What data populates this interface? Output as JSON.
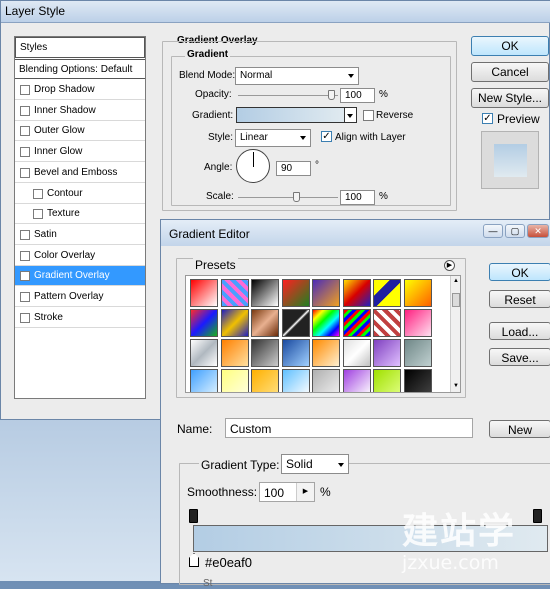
{
  "layer_style": {
    "title": "Layer Style",
    "styles_header": "Styles",
    "blending_options": "Blending Options: Default",
    "items": [
      {
        "label": "Drop Shadow",
        "checked": false,
        "sub": false
      },
      {
        "label": "Inner Shadow",
        "checked": false,
        "sub": false
      },
      {
        "label": "Outer Glow",
        "checked": false,
        "sub": false
      },
      {
        "label": "Inner Glow",
        "checked": false,
        "sub": false
      },
      {
        "label": "Bevel and Emboss",
        "checked": false,
        "sub": false
      },
      {
        "label": "Contour",
        "checked": false,
        "sub": true
      },
      {
        "label": "Texture",
        "checked": false,
        "sub": true
      },
      {
        "label": "Satin",
        "checked": false,
        "sub": false
      },
      {
        "label": "Color Overlay",
        "checked": false,
        "sub": false
      },
      {
        "label": "Gradient Overlay",
        "checked": true,
        "sub": false,
        "selected": true
      },
      {
        "label": "Pattern Overlay",
        "checked": false,
        "sub": false
      },
      {
        "label": "Stroke",
        "checked": false,
        "sub": false
      }
    ],
    "section_title": "Gradient Overlay",
    "group_title": "Gradient",
    "blend_mode_label": "Blend Mode:",
    "blend_mode_value": "Normal",
    "opacity_label": "Opacity:",
    "opacity_value": "100",
    "opacity_unit": "%",
    "gradient_label": "Gradient:",
    "reverse_label": "Reverse",
    "style_label": "Style:",
    "style_value": "Linear",
    "align_label": "Align with Layer",
    "angle_label": "Angle:",
    "angle_value": "90",
    "angle_unit": "°",
    "scale_label": "Scale:",
    "scale_value": "100",
    "scale_unit": "%",
    "ok": "OK",
    "cancel": "Cancel",
    "new_style": "New Style...",
    "preview": "Preview",
    "preview_checked": true
  },
  "gradient_editor": {
    "title": "Gradient Editor",
    "presets_label": "Presets",
    "ok": "OK",
    "reset": "Reset",
    "load": "Load...",
    "save": "Save...",
    "name_label": "Name:",
    "name_value": "Custom",
    "new_button": "New",
    "gradient_type_label": "Gradient Type:",
    "gradient_type_value": "Solid",
    "smoothness_label": "Smoothness:",
    "smoothness_value": "100",
    "smoothness_unit": "%",
    "stop_color": "#e0eaf0",
    "window_controls": [
      "—",
      "▢",
      "✕"
    ]
  },
  "colors": {
    "gradient_start": "#b3cde4",
    "gradient_end": "#e0eaf0",
    "selection": "#3399ff"
  },
  "watermark": {
    "chars": "建站学",
    "url": "jzxue.com"
  }
}
